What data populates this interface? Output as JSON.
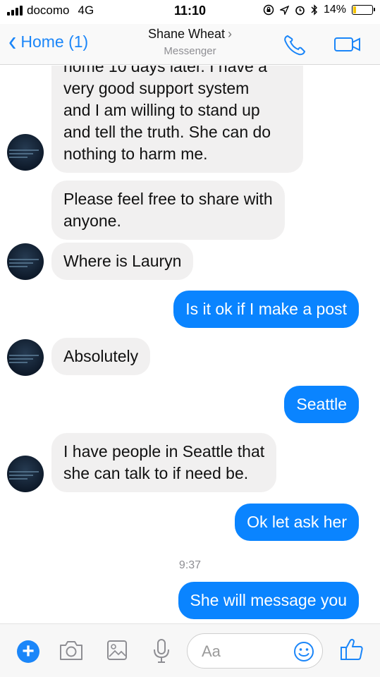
{
  "status_bar": {
    "carrier": "docomo",
    "network": "4G",
    "time": "11:10",
    "battery_pct": "14%",
    "battery_level": 0.14
  },
  "header": {
    "back_label": "Home (1)",
    "contact_name": "Shane Wheat",
    "subtitle": "Messenger"
  },
  "messages": [
    {
      "dir": "in",
      "lines": [
        "home 10 days later. I have a",
        "very good support system",
        "and I  am willing to stand up",
        "and tell the truth. She can do",
        "nothing to harm me."
      ]
    },
    {
      "dir": "in",
      "lines": [
        "Please feel free to share with",
        "anyone."
      ]
    },
    {
      "dir": "in",
      "lines": [
        "Where is Lauryn"
      ]
    },
    {
      "dir": "out",
      "lines": [
        "Is it ok if I make a post"
      ]
    },
    {
      "dir": "in",
      "lines": [
        "Absolutely"
      ]
    },
    {
      "dir": "out",
      "lines": [
        "Seattle"
      ]
    },
    {
      "dir": "in",
      "lines": [
        "I have people in Seattle that",
        "she can talk to if need be."
      ]
    },
    {
      "dir": "out",
      "lines": [
        "Ok let ask her"
      ]
    },
    {
      "dir": "out",
      "lines": [
        "She will message you"
      ]
    }
  ],
  "timestamp": "9:37",
  "composer": {
    "placeholder": "Aa"
  },
  "icons": [
    "plus-icon",
    "camera-icon",
    "gallery-icon",
    "microphone-icon",
    "emoji-icon",
    "thumbs-up-icon",
    "phone-icon",
    "video-icon"
  ],
  "colors": {
    "accent": "#1b86f9",
    "outgoing_bubble": "#0a84ff",
    "incoming_bubble": "#f1f0f0"
  }
}
